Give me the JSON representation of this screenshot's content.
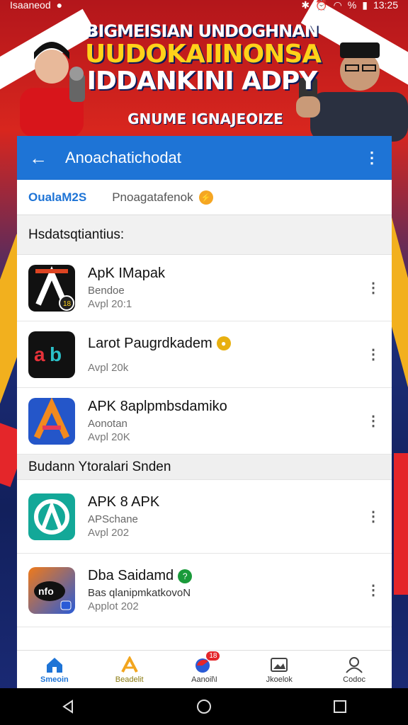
{
  "status_bar": {
    "left_text": "Isaaneod",
    "time": "13:25",
    "battery": "%"
  },
  "banner": {
    "line1": "BIGMEISIAN UNDOGHNAN",
    "line2": "UUDOKAIINONSA",
    "line3": "IDDANKINI ADPY",
    "line4": "GNUME IGNAJEOIZE"
  },
  "app_bar": {
    "title": "Anoachatichodat",
    "back_icon": "arrow-left-icon",
    "more_icon": "more-vert-icon",
    "color": "#1e74d6"
  },
  "tabs": [
    {
      "label": "OualaM2S",
      "active": true
    },
    {
      "label": "Pnoagatafenok",
      "active": false,
      "badge": "⚡"
    }
  ],
  "section1": {
    "title": "Hsdatsqtiantius:",
    "items": [
      {
        "title": "ApK IMapak",
        "sub": "Bendoe",
        "meta": "Avpl 20:1",
        "icon": "apk-a-icon"
      },
      {
        "title": "Larot Paugrdkadem",
        "sub": "",
        "meta": "Avpl 20k",
        "icon": "ab-icon",
        "badge": "●"
      },
      {
        "title": "APK 8aplpmbsdamiko",
        "sub": "Aonotan",
        "meta": "Avpl 20K",
        "icon": "apk-a-gradient-icon"
      }
    ]
  },
  "section2": {
    "title": "Budann Ytoralari Snden",
    "items": [
      {
        "title": "APK 8 APK",
        "sub": "APSchane",
        "meta": "Avpl 202",
        "icon": "teal-a-icon"
      },
      {
        "title": "Dba Saidamd",
        "sub": "Bas qlanipmkatkovoN",
        "meta": "Applot 202",
        "icon": "nfo-icon",
        "badge": "?"
      }
    ]
  },
  "bottom_nav": [
    {
      "label": "Smeoin",
      "icon": "home-icon",
      "active": true
    },
    {
      "label": "Beadelit",
      "icon": "apk-logo-icon",
      "active": false
    },
    {
      "label": "Aanoil\\I",
      "icon": "notification-icon",
      "active": false,
      "badge": "18"
    },
    {
      "label": "Jkoelok",
      "icon": "gallery-icon",
      "active": false
    },
    {
      "label": "Codoc",
      "icon": "profile-icon",
      "active": false
    }
  ]
}
